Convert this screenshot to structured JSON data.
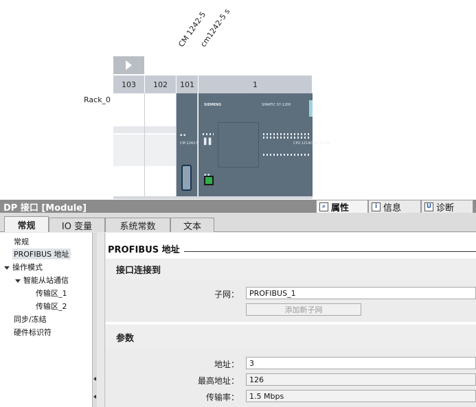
{
  "rack": {
    "module_labels": [
      "CM 1242-5",
      "cm1242-5 s"
    ],
    "slot_numbers": [
      "103",
      "102",
      "101",
      "1"
    ],
    "rack_name": "Rack_0",
    "cpu_brand": "SIEMENS",
    "cpu_model": "SIMATIC S7-1200",
    "cm_text": "CM 1242-5\nDP",
    "cpu_side_text": "CPU 1214C\nDC/DC/DC"
  },
  "inspector": {
    "title": "DP 接口 [Module]",
    "top_tabs": [
      {
        "label": "属性",
        "icon": "properties-icon"
      },
      {
        "label": "信息",
        "icon": "info-icon"
      },
      {
        "label": "诊断",
        "icon": "diagnostics-icon"
      }
    ],
    "tabs": [
      "常规",
      "IO 变量",
      "系统常数",
      "文本"
    ],
    "nav": {
      "items": [
        "常规",
        "PROFIBUS 地址",
        "操作模式",
        "智能从站通信",
        "传输区_1",
        "传输区_2",
        "同步/冻结",
        "硬件标识符"
      ]
    },
    "content": {
      "heading": "PROFIBUS 地址",
      "section1_title": "接口连接到",
      "subnet_label": "子网：",
      "subnet_value": "PROFIBUS_1",
      "add_subnet_button": "添加新子网",
      "section2_title": "参数",
      "address_label": "地址：",
      "address_value": "3",
      "max_address_label": "最高地址：",
      "max_address_value": "126",
      "rate_label": "传输率：",
      "rate_value": "1.5 Mbps"
    }
  }
}
